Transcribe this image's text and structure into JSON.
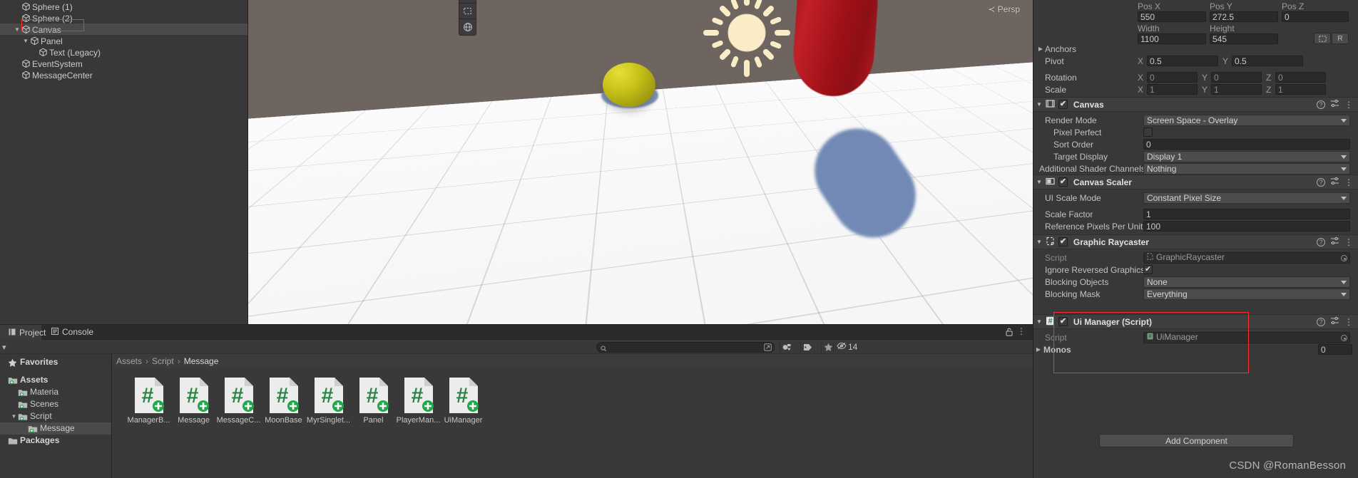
{
  "app": {
    "name": "Unity Editor",
    "watermark": "CSDN @RomanBesson"
  },
  "hierarchy": {
    "items": [
      {
        "label": "Sphere (1)",
        "indent": 1,
        "foldout": "",
        "selected": false
      },
      {
        "label": "Sphere (2)",
        "indent": 1,
        "foldout": "",
        "selected": false
      },
      {
        "label": "Canvas",
        "indent": 1,
        "foldout": "▼",
        "selected": true
      },
      {
        "label": "Panel",
        "indent": 2,
        "foldout": "▼",
        "selected": false
      },
      {
        "label": "Text (Legacy)",
        "indent": 3,
        "foldout": "",
        "selected": false
      },
      {
        "label": "EventSystem",
        "indent": 1,
        "foldout": "",
        "selected": false
      },
      {
        "label": "MessageCenter",
        "indent": 1,
        "foldout": "",
        "selected": false
      }
    ]
  },
  "scene": {
    "persp_label": "≺ Persp",
    "tools": [
      "move-tool-icon",
      "rect-tool-icon",
      "transform-tool-icon"
    ],
    "objects": [
      {
        "name": "yellow-sphere",
        "color": "#c9c318"
      },
      {
        "name": "red-capsule",
        "color": "#a8161c"
      },
      {
        "name": "blue-capsule-shadow",
        "color": "#7189b4"
      },
      {
        "name": "directional-light-gizmo",
        "color": "#fbecc8"
      }
    ]
  },
  "project": {
    "tabs": [
      {
        "label": "Project",
        "icon": "project-icon",
        "active": true
      },
      {
        "label": "Console",
        "icon": "console-icon",
        "active": false
      }
    ],
    "search": {
      "value": "",
      "placeholder": ""
    },
    "hidden_count": "14",
    "breadcrumb": [
      "Assets",
      "Script",
      "Message"
    ],
    "tree": [
      {
        "label": "Favorites",
        "indent": 0,
        "foldout": "",
        "icon": "star-icon",
        "bold": true,
        "selected": false
      },
      {
        "label": "",
        "indent": 0,
        "foldout": "",
        "icon": "",
        "bold": false,
        "selected": false,
        "spacer": true
      },
      {
        "label": "Assets",
        "indent": 0,
        "foldout": "",
        "icon": "folder-icon",
        "bold": true,
        "selected": false
      },
      {
        "label": "Materia",
        "indent": 1,
        "foldout": "",
        "icon": "folder-icon",
        "bold": false,
        "selected": false
      },
      {
        "label": "Scenes",
        "indent": 1,
        "foldout": "",
        "icon": "folder-icon",
        "bold": false,
        "selected": false
      },
      {
        "label": "Script",
        "indent": 1,
        "foldout": "▼",
        "icon": "folder-icon",
        "bold": false,
        "selected": false
      },
      {
        "label": "Message",
        "indent": 2,
        "foldout": "",
        "icon": "folder-icon",
        "bold": false,
        "selected": true
      },
      {
        "label": "Packages",
        "indent": 0,
        "foldout": "",
        "icon": "folder-icon",
        "bold": true,
        "selected": false
      }
    ],
    "assets": [
      {
        "name": "ManagerB...",
        "type": "csharp-script"
      },
      {
        "name": "Message",
        "type": "csharp-script"
      },
      {
        "name": "MessageC...",
        "type": "csharp-script"
      },
      {
        "name": "MoonBase",
        "type": "csharp-script"
      },
      {
        "name": "MyrSinglet...",
        "type": "csharp-script"
      },
      {
        "name": "Panel",
        "type": "csharp-script"
      },
      {
        "name": "PlayerMan...",
        "type": "csharp-script"
      },
      {
        "name": "UiManager",
        "type": "csharp-script"
      }
    ]
  },
  "inspector": {
    "rect_transform": {
      "headers": {
        "pos_x": "Pos X",
        "pos_y": "Pos Y",
        "pos_z": "Pos Z",
        "width": "Width",
        "height": "Height"
      },
      "pos_x": "550",
      "pos_y": "272.5",
      "pos_z": "0",
      "width": "1100",
      "height": "545",
      "blueprint_label": "",
      "raw_label": "R",
      "anchors_label": "Anchors",
      "pivot_label": "Pivot",
      "pivot_x": "0.5",
      "pivot_y": "0.5",
      "rotation_label": "Rotation",
      "rotation_x": "0",
      "rotation_y": "0",
      "rotation_z": "0",
      "scale_label": "Scale",
      "scale_x": "1",
      "scale_y": "1",
      "scale_z": "1"
    },
    "canvas": {
      "title": "Canvas",
      "enabled": true,
      "render_mode_label": "Render Mode",
      "render_mode_value": "Screen Space - Overlay",
      "pixel_perfect_label": "Pixel Perfect",
      "pixel_perfect_value": false,
      "sort_order_label": "Sort Order",
      "sort_order_value": "0",
      "target_display_label": "Target Display",
      "target_display_value": "Display 1",
      "shader_channels_label": "Additional Shader Channels",
      "shader_channels_value": "Nothing"
    },
    "canvas_scaler": {
      "title": "Canvas Scaler",
      "enabled": true,
      "ui_scale_mode_label": "UI Scale Mode",
      "ui_scale_mode_value": "Constant Pixel Size",
      "scale_factor_label": "Scale Factor",
      "scale_factor_value": "1",
      "ref_ppu_label": "Reference Pixels Per Unit",
      "ref_ppu_value": "100"
    },
    "graphic_raycaster": {
      "title": "Graphic Raycaster",
      "enabled": true,
      "script_label": "Script",
      "script_value": "GraphicRaycaster",
      "ignore_reversed_label": "Ignore Reversed Graphics",
      "ignore_reversed_value": true,
      "blocking_objects_label": "Blocking Objects",
      "blocking_objects_value": "None",
      "blocking_mask_label": "Blocking Mask",
      "blocking_mask_value": "Everything"
    },
    "ui_manager": {
      "title": "Ui Manager (Script)",
      "enabled": true,
      "script_label": "Script",
      "script_value": "UiManager",
      "monos_label": "Monos",
      "monos_value": "0"
    },
    "add_component_label": "Add Component",
    "highlight_color": "#ff2d2d"
  }
}
